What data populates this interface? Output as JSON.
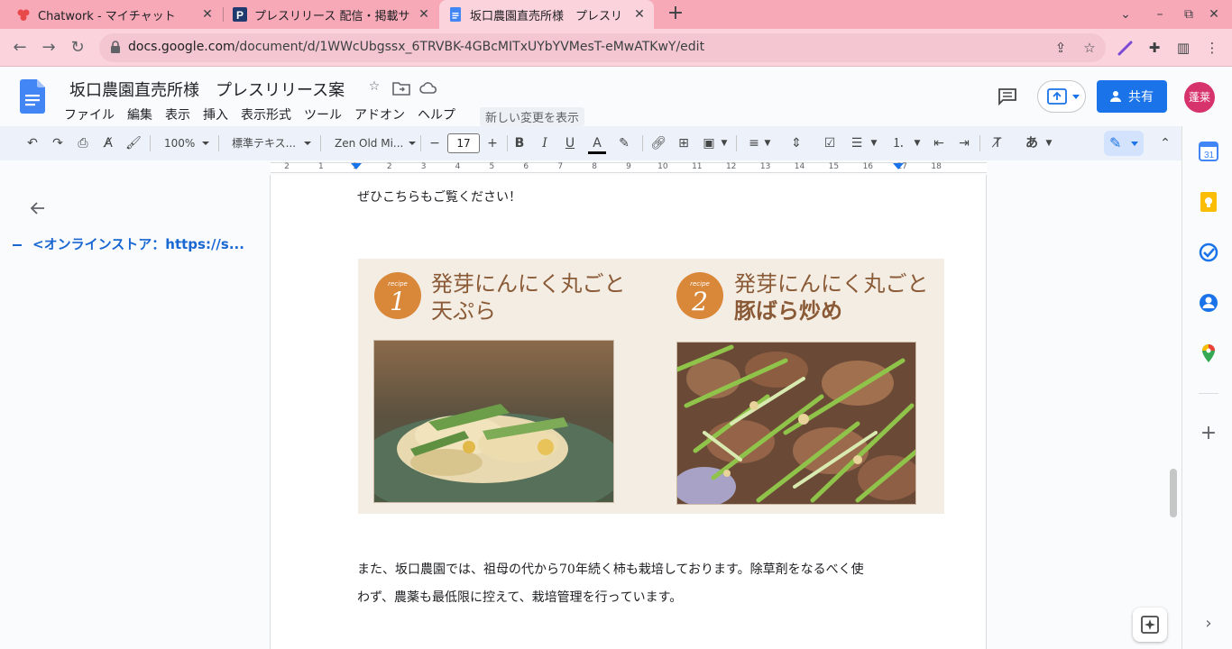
{
  "browser": {
    "tabs": [
      {
        "title": "Chatwork - マイチャット",
        "active": false
      },
      {
        "title": "プレスリリース 配信・掲載サ",
        "active": false
      },
      {
        "title": "坂口農園直売所様　プレスリ",
        "active": true
      }
    ],
    "url_host": "docs.google.com",
    "url_path": "/document/d/1WWcUbgssx_6TRVBK-4GBcMITxUYbYVMesT-eMwATKwY/edit"
  },
  "doc": {
    "title": "坂口農園直売所様　プレスリリース案",
    "menu": [
      "ファイル",
      "編集",
      "表示",
      "挿入",
      "表示形式",
      "ツール",
      "アドオン",
      "ヘルプ"
    ],
    "last_edit": "新しい変更を表示",
    "share_label": "共有",
    "avatar_label": "蓬莱"
  },
  "toolbar": {
    "zoom": "100%",
    "style": "標準テキス...",
    "font": "Zen Old Mi...",
    "font_size": "17",
    "input_mode": "あ"
  },
  "ruler": {
    "labels": [
      "2",
      "1",
      "1",
      "2",
      "3",
      "4",
      "5",
      "6",
      "7",
      "8",
      "9",
      "10",
      "11",
      "12",
      "13",
      "14",
      "15",
      "16",
      "17",
      "18"
    ]
  },
  "outline": {
    "item": "<オンラインストア：https://s..."
  },
  "content": {
    "line_top": "ぜひこちらもご覧ください！",
    "recipe1_badge_small": "recipe",
    "recipe1_num": "1",
    "recipe1_title_1": "発芽にんにく丸ごと",
    "recipe1_title_2": "天ぷら",
    "recipe2_badge_small": "recipe",
    "recipe2_num": "2",
    "recipe2_title_1": "発芽にんにく丸ごと",
    "recipe2_title_2": "豚ばら炒め",
    "para_line1": "また、坂口農園では、祖母の代から70年続く柿も栽培しております。除草剤をなるべく使",
    "para_line2": "わず、農薬も最低限に控えて、栽培管理を行っています。"
  },
  "colors": {
    "tab_strip": "#f7a9b8",
    "accent": "#1a73e8",
    "avatar": "#d6336c"
  }
}
